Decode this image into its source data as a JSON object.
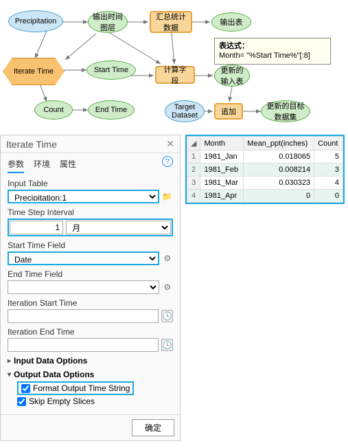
{
  "diagram": {
    "precipitation": "Precipitation",
    "iterate_time": "Iterate Time",
    "start_time": "Start Time",
    "count": "Count",
    "end_time": "End Time",
    "output_layer": "输出时间\n图层",
    "agg_stats": "汇总统计\n数据",
    "output_table": "输出表",
    "calc_field": "计算字段",
    "input_table": "更新的\n输入表",
    "target_dataset": "Target\nDataset",
    "append": "追加",
    "updated_target": "更新的目标\n数据集",
    "tooltip_title": "表达式：",
    "tooltip_body": "Month= \"%Start Time%\"[:8]"
  },
  "panel": {
    "title": "Iterate Time",
    "tabs": {
      "params": "参数",
      "env": "环境",
      "attrs": "属性"
    },
    "labels": {
      "input_table": "Input Table",
      "time_step": "Time Step Interval",
      "start_field": "Start Time Field",
      "end_field": "End Time Field",
      "iter_start": "Iteration Start Time",
      "iter_end": "Iteration End Time",
      "input_opts": "Input Data Options",
      "output_opts": "Output Data Options",
      "format_str": "Format Output Time String",
      "skip_empty": "Skip Empty Slices",
      "ok": "确定"
    },
    "values": {
      "input_table": "Precipitation:1",
      "step_num": "1",
      "step_unit": "月",
      "start_field": "Date",
      "end_field": "",
      "iter_start": "",
      "iter_end": ""
    }
  },
  "table": {
    "headers": {
      "month": "Month",
      "mean": "Mean_ppt(inches)",
      "count": "Count"
    },
    "rows": [
      {
        "n": "1",
        "month": "1981_Jan",
        "mean": "0.018065",
        "count": "5",
        "sel": false
      },
      {
        "n": "2",
        "month": "1981_Feb",
        "mean": "0.008214",
        "count": "3",
        "sel": true
      },
      {
        "n": "3",
        "month": "1981_Mar",
        "mean": "0.030323",
        "count": "4",
        "sel": false
      },
      {
        "n": "4",
        "month": "1981_Apr",
        "mean": "0",
        "count": "0",
        "sel": true
      }
    ]
  },
  "chart_data": {
    "type": "table",
    "headers": [
      "Month",
      "Mean_ppt(inches)",
      "Count"
    ],
    "rows": [
      [
        "1981_Jan",
        0.018065,
        5
      ],
      [
        "1981_Feb",
        0.008214,
        3
      ],
      [
        "1981_Mar",
        0.030323,
        4
      ],
      [
        "1981_Apr",
        0,
        0
      ]
    ]
  }
}
